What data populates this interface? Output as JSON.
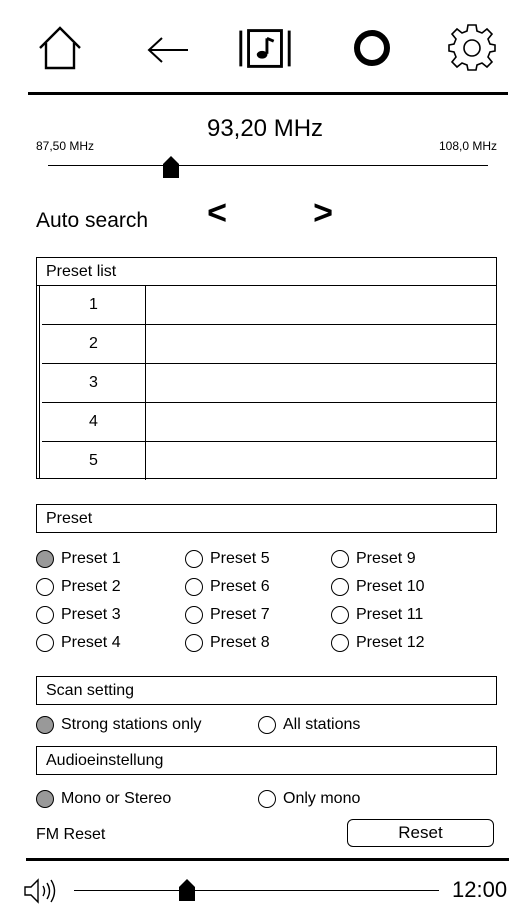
{
  "toolbar": {
    "icons": [
      "home-icon",
      "back-arrow-icon",
      "music-library-icon",
      "ring-icon",
      "gear-icon"
    ]
  },
  "tuner": {
    "current": "93,20 MHz",
    "min": "87,50 MHz",
    "max": "108,0 MHz",
    "position": 0.28
  },
  "auto_search": {
    "label": "Auto search",
    "prev": "<",
    "next": ">"
  },
  "preset_list": {
    "title": "Preset list",
    "rows": [
      {
        "num": "1",
        "name": ""
      },
      {
        "num": "2",
        "name": ""
      },
      {
        "num": "3",
        "name": ""
      },
      {
        "num": "4",
        "name": ""
      },
      {
        "num": "5",
        "name": ""
      }
    ]
  },
  "preset": {
    "title": "Preset",
    "options": [
      "Preset 1",
      "Preset 2",
      "Preset 3",
      "Preset 4",
      "Preset 5",
      "Preset 6",
      "Preset 7",
      "Preset 8",
      "Preset 9",
      "Preset 10",
      "Preset 11",
      "Preset 12"
    ],
    "selected": "Preset 1"
  },
  "scan": {
    "title": "Scan setting",
    "options": [
      "Strong stations only",
      "All stations"
    ],
    "selected": "Strong stations only"
  },
  "audio": {
    "title": "Audioeinstellung",
    "options": [
      "Mono or Stereo",
      "Only mono"
    ],
    "selected": "Mono or Stereo"
  },
  "reset": {
    "label": "FM Reset",
    "button": "Reset"
  },
  "footer": {
    "volume_icon": "speaker-icon",
    "volume": 0.31,
    "time": "12:00"
  },
  "colors": {
    "selected_radio": "#999999",
    "line": "#000000"
  }
}
